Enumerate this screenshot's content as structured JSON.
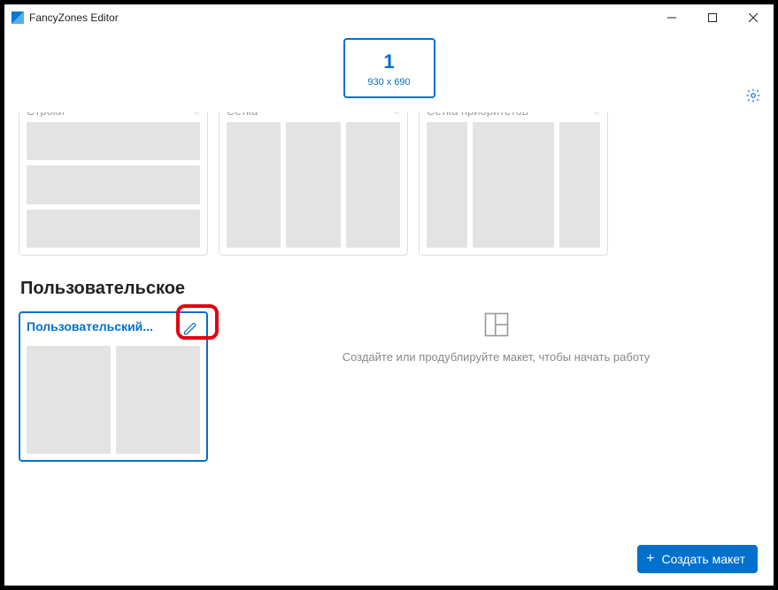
{
  "window": {
    "title": "FancyZones Editor"
  },
  "monitor": {
    "number": "1",
    "resolution": "930 x 690"
  },
  "templates": [
    {
      "title": "Строки",
      "type": "rows"
    },
    {
      "title": "Сетка",
      "type": "cols"
    },
    {
      "title": "Сетка приоритетов",
      "type": "priority"
    }
  ],
  "section_custom_title": "Пользовательское",
  "custom_layout": {
    "title": "Пользовательский..."
  },
  "empty_hint": "Создайте или продублируйте макет, чтобы начать работу",
  "create_button": "Создать макет"
}
